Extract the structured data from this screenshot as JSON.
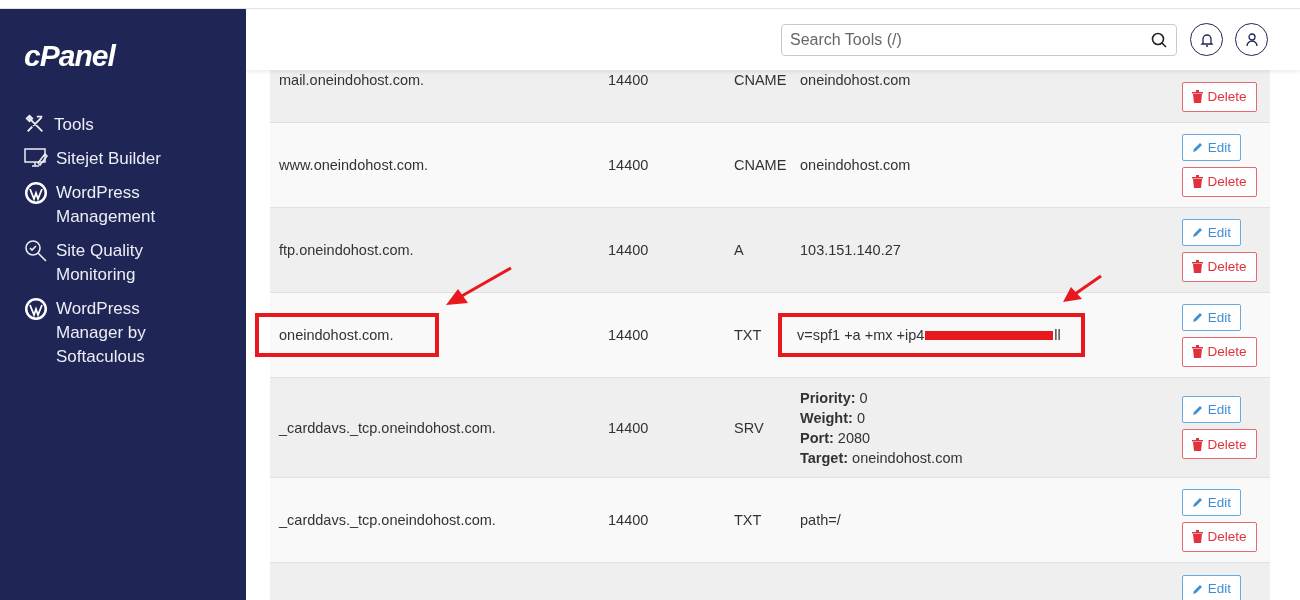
{
  "sidebar": {
    "logo": "cPanel",
    "items": [
      {
        "kind": "tools",
        "label": "Tools"
      },
      {
        "kind": "monitor",
        "label": "Sitejet Builder"
      },
      {
        "kind": "wordpress",
        "label": "WordPress Management"
      },
      {
        "kind": "quality",
        "label": "Site Quality Monitoring"
      },
      {
        "kind": "wordpress",
        "label": "WordPress Manager by Softaculous"
      }
    ]
  },
  "header": {
    "search": {
      "placeholder": "Search Tools (/)"
    }
  },
  "records": [
    {
      "kind": "plain",
      "name": "mail.oneindohost.com.",
      "ttl": "14400",
      "type": "CNAME",
      "value": "oneindohost.com",
      "actions": [
        {
          "kind": "delete",
          "label": "Delete"
        }
      ]
    },
    {
      "kind": "plain",
      "name": "www.oneindohost.com.",
      "ttl": "14400",
      "type": "CNAME",
      "value": "oneindohost.com",
      "actions": [
        {
          "kind": "edit",
          "label": "Edit"
        },
        {
          "kind": "delete",
          "label": "Delete"
        }
      ]
    },
    {
      "kind": "plain",
      "name": "ftp.oneindohost.com.",
      "ttl": "14400",
      "type": "A",
      "value": "103.151.140.27",
      "actions": [
        {
          "kind": "edit",
          "label": "Edit"
        },
        {
          "kind": "delete",
          "label": "Delete"
        }
      ]
    },
    {
      "kind": "redacted",
      "name": "oneindohost.com.",
      "ttl": "14400",
      "type": "TXT",
      "value": "v=spf1 +a +mx +ip4",
      "value_tail": "ll",
      "highlighted": true,
      "actions": [
        {
          "kind": "edit",
          "label": "Edit"
        },
        {
          "kind": "delete",
          "label": "Delete"
        }
      ]
    },
    {
      "kind": "srv",
      "name": "_carddavs._tcp.oneindohost.com.",
      "ttl": "14400",
      "type": "SRV",
      "details": [
        {
          "label": "Priority:",
          "value": "0"
        },
        {
          "label": "Weight:",
          "value": "0"
        },
        {
          "label": "Port:",
          "value": "2080"
        },
        {
          "label": "Target:",
          "value": "oneindohost.com"
        }
      ],
      "actions": [
        {
          "kind": "edit",
          "label": "Edit"
        },
        {
          "kind": "delete",
          "label": "Delete"
        }
      ]
    },
    {
      "kind": "plain",
      "name": "_carddavs._tcp.oneindohost.com.",
      "ttl": "14400",
      "type": "TXT",
      "value": "path=/",
      "actions": [
        {
          "kind": "edit",
          "label": "Edit"
        },
        {
          "kind": "delete",
          "label": "Delete"
        }
      ]
    },
    {
      "kind": "empty",
      "actions": [
        {
          "kind": "edit",
          "label": "Edit"
        }
      ]
    }
  ]
}
